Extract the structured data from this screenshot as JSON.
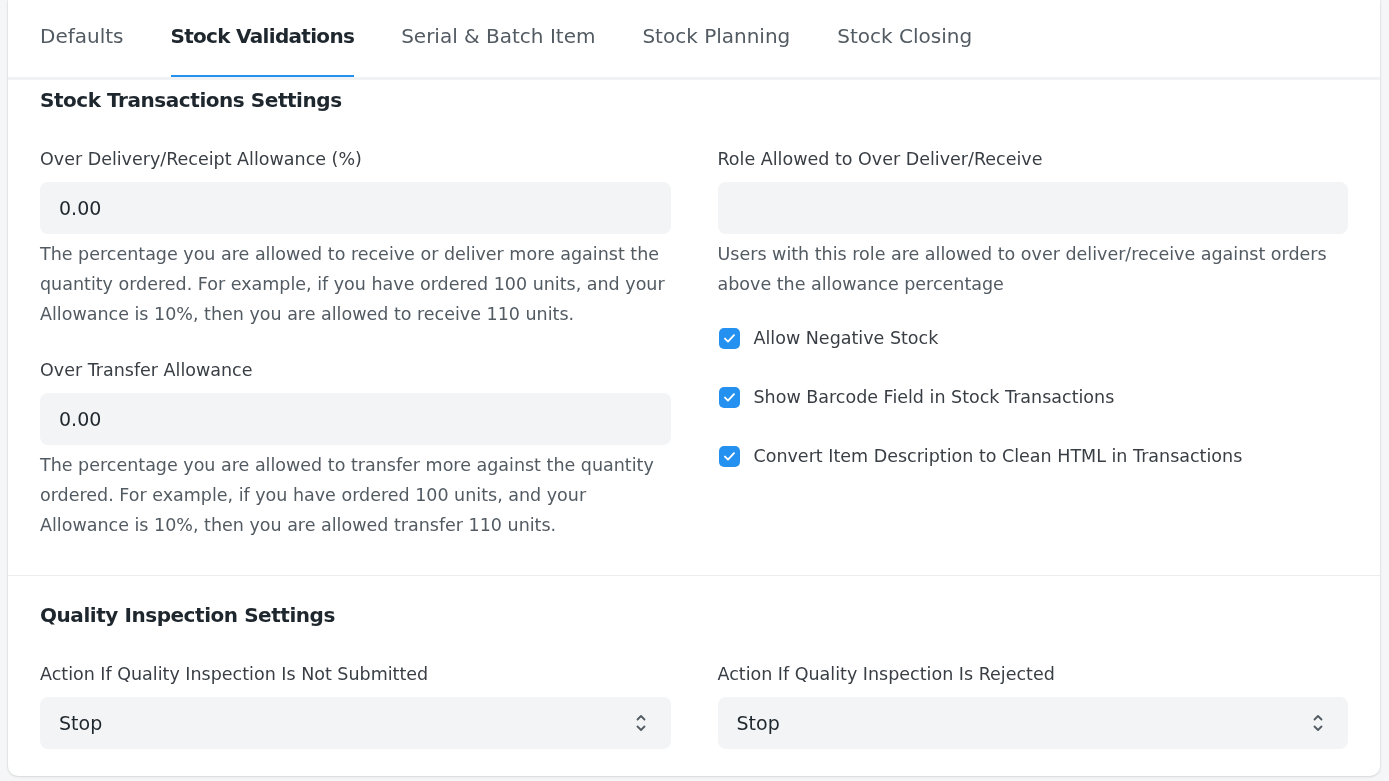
{
  "tabs": [
    {
      "label": "Defaults",
      "selected": false
    },
    {
      "label": "Stock Validations",
      "selected": true
    },
    {
      "label": "Serial & Batch Item",
      "selected": false
    },
    {
      "label": "Stock Planning",
      "selected": false
    },
    {
      "label": "Stock Closing",
      "selected": false
    }
  ],
  "sections": [
    {
      "title": "Stock Transactions Settings",
      "columns": [
        [
          {
            "kind": "input",
            "label": "Over Delivery/Receipt Allowance (%)",
            "value": "0.00",
            "description": "The percentage you are allowed to receive or deliver more against the quantity ordered. For example, if you have ordered 100 units, and your Allowance is 10%, then you are allowed to receive 110 units."
          },
          {
            "kind": "input",
            "label": "Over Transfer Allowance",
            "value": "0.00",
            "description": "The percentage you are allowed to transfer more against the quantity ordered. For example, if you have ordered 100 units, and your Allowance is 10%, then you are allowed transfer 110 units."
          }
        ],
        [
          {
            "kind": "input",
            "label": "Role Allowed to Over Deliver/Receive",
            "description": "Users with this role are allowed to over deliver/receive against orders above the allowance percentage"
          },
          {
            "kind": "checkbox",
            "label": "Allow Negative Stock",
            "checked": true
          },
          {
            "kind": "checkbox",
            "label": "Show Barcode Field in Stock Transactions",
            "checked": true
          },
          {
            "kind": "checkbox",
            "label": "Convert Item Description to Clean HTML in Transactions",
            "checked": true
          }
        ]
      ]
    },
    {
      "title": "Quality Inspection Settings",
      "columns": [
        [
          {
            "kind": "select",
            "label": "Action If Quality Inspection Is Not Submitted",
            "value": "Stop"
          }
        ],
        [
          {
            "kind": "select",
            "label": "Action If Quality Inspection Is Rejected",
            "value": "Stop"
          }
        ]
      ]
    }
  ]
}
